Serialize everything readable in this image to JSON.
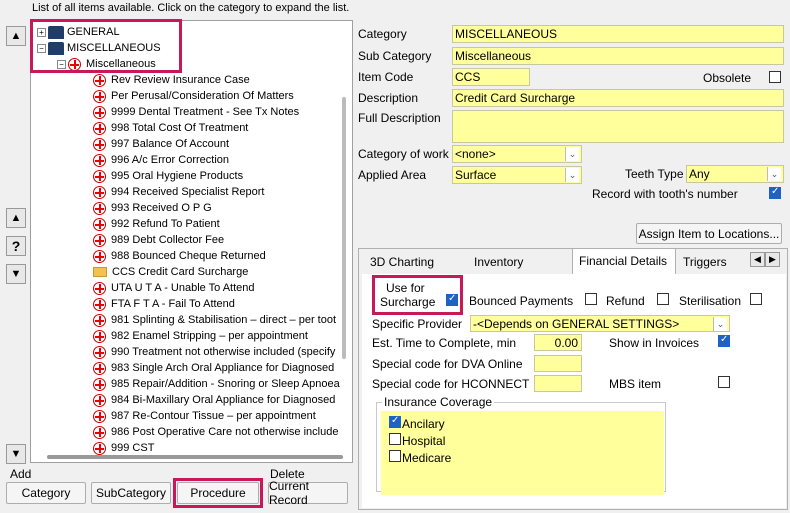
{
  "header": {
    "text": "List of all items available. Click on the category to expand the list."
  },
  "tree": {
    "categories": [
      {
        "label": "GENERAL"
      },
      {
        "label": "MISCELLANEOUS"
      }
    ],
    "subcategory": {
      "label": "Miscellaneous"
    },
    "items": [
      {
        "label": "Rev Review Insurance Case",
        "icon": "cross"
      },
      {
        "label": "Per Perusal/Consideration Of Matters",
        "icon": "cross"
      },
      {
        "label": "9999 Dental Treatment - See Tx Notes",
        "icon": "cross"
      },
      {
        "label": "998 Total Cost Of Treatment",
        "icon": "cross"
      },
      {
        "label": "997 Balance Of Account",
        "icon": "cross"
      },
      {
        "label": "996 A/c Error Correction",
        "icon": "cross"
      },
      {
        "label": "995 Oral Hygiene Products",
        "icon": "cross"
      },
      {
        "label": "994 Received Specialist Report",
        "icon": "cross"
      },
      {
        "label": "993 Received O P G",
        "icon": "cross"
      },
      {
        "label": "992 Refund To Patient",
        "icon": "cross"
      },
      {
        "label": "989 Debt Collector Fee",
        "icon": "cross"
      },
      {
        "label": "988 Bounced Cheque Returned",
        "icon": "cross"
      },
      {
        "label": "CCS Credit Card Surcharge",
        "icon": "folder"
      },
      {
        "label": "UTA U T A - Unable To Attend",
        "icon": "cross"
      },
      {
        "label": "FTA F T A - Fail To Attend",
        "icon": "cross"
      },
      {
        "label": "981 Splinting & Stabilisation  – direct – per toot",
        "icon": "cross"
      },
      {
        "label": "982 Enamel Stripping  – per appointment",
        "icon": "cross"
      },
      {
        "label": "990 Treatment not otherwise included (specify",
        "icon": "cross"
      },
      {
        "label": "983 Single Arch Oral Appliance for Diagnosed",
        "icon": "cross"
      },
      {
        "label": "985 Repair/Addition - Snoring or Sleep Apnoea",
        "icon": "cross"
      },
      {
        "label": "984 Bi-Maxillary Oral Appliance for Diagnosed",
        "icon": "cross"
      },
      {
        "label": "987 Re-Contour Tissue  – per appointment",
        "icon": "cross"
      },
      {
        "label": "986 Post Operative Care not otherwise include",
        "icon": "cross"
      },
      {
        "label": "999 CST",
        "icon": "cross"
      }
    ]
  },
  "bottom": {
    "add_label": "Add",
    "delete_label": "Delete",
    "buttons": {
      "category": "Category",
      "subcategory": "SubCategory",
      "procedure": "Procedure",
      "current_record": "Current Record"
    }
  },
  "form": {
    "category": {
      "label": "Category",
      "value": "MISCELLANEOUS"
    },
    "sub_category": {
      "label": "Sub Category",
      "value": "Miscellaneous"
    },
    "item_code": {
      "label": "Item Code",
      "value": "CCS"
    },
    "obsolete": {
      "label": "Obsolete"
    },
    "description": {
      "label": "Description",
      "value": "Credit Card Surcharge"
    },
    "full_description": {
      "label": "Full Description",
      "value": ""
    },
    "category_of_work": {
      "label": "Category of work",
      "value": "<none>"
    },
    "applied_area": {
      "label": "Applied Area",
      "value": "Surface"
    },
    "teeth_type": {
      "label": "Teeth Type",
      "value": "Any"
    },
    "record_with_tooth": {
      "label": "Record with tooth's number",
      "checked": true
    },
    "assign_button": "Assign Item to Locations..."
  },
  "tabs": [
    {
      "label": "3D Charting"
    },
    {
      "label": "Inventory"
    },
    {
      "label": "Financial Details"
    },
    {
      "label": "Triggers"
    }
  ],
  "financial": {
    "use_for_surcharge": {
      "label_line1": "Use for",
      "label_line2": "Surcharge",
      "checked": true
    },
    "bounced_payments": {
      "label": "Bounced Payments",
      "checked": false
    },
    "refund": {
      "label": "Refund",
      "checked": false
    },
    "sterilisation": {
      "label": "Sterilisation",
      "checked": false
    },
    "specific_provider": {
      "label": "Specific Provider",
      "value": "-<Depends on GENERAL SETTINGS>"
    },
    "est_time": {
      "label": "Est. Time to Complete, min",
      "value": "0.00"
    },
    "show_in_invoices": {
      "label": "Show in Invoices",
      "checked": true
    },
    "dva_code": {
      "label": "Special code for DVA Online",
      "value": ""
    },
    "hconnect_code": {
      "label": "Special code for HCONNECT",
      "value": ""
    },
    "mbs_item": {
      "label": "MBS item",
      "checked": false
    },
    "insurance": {
      "title": "Insurance Coverage",
      "options": [
        {
          "label": "Ancilary",
          "checked": true
        },
        {
          "label": "Hospital",
          "checked": false
        },
        {
          "label": "Medicare",
          "checked": false
        }
      ]
    }
  }
}
